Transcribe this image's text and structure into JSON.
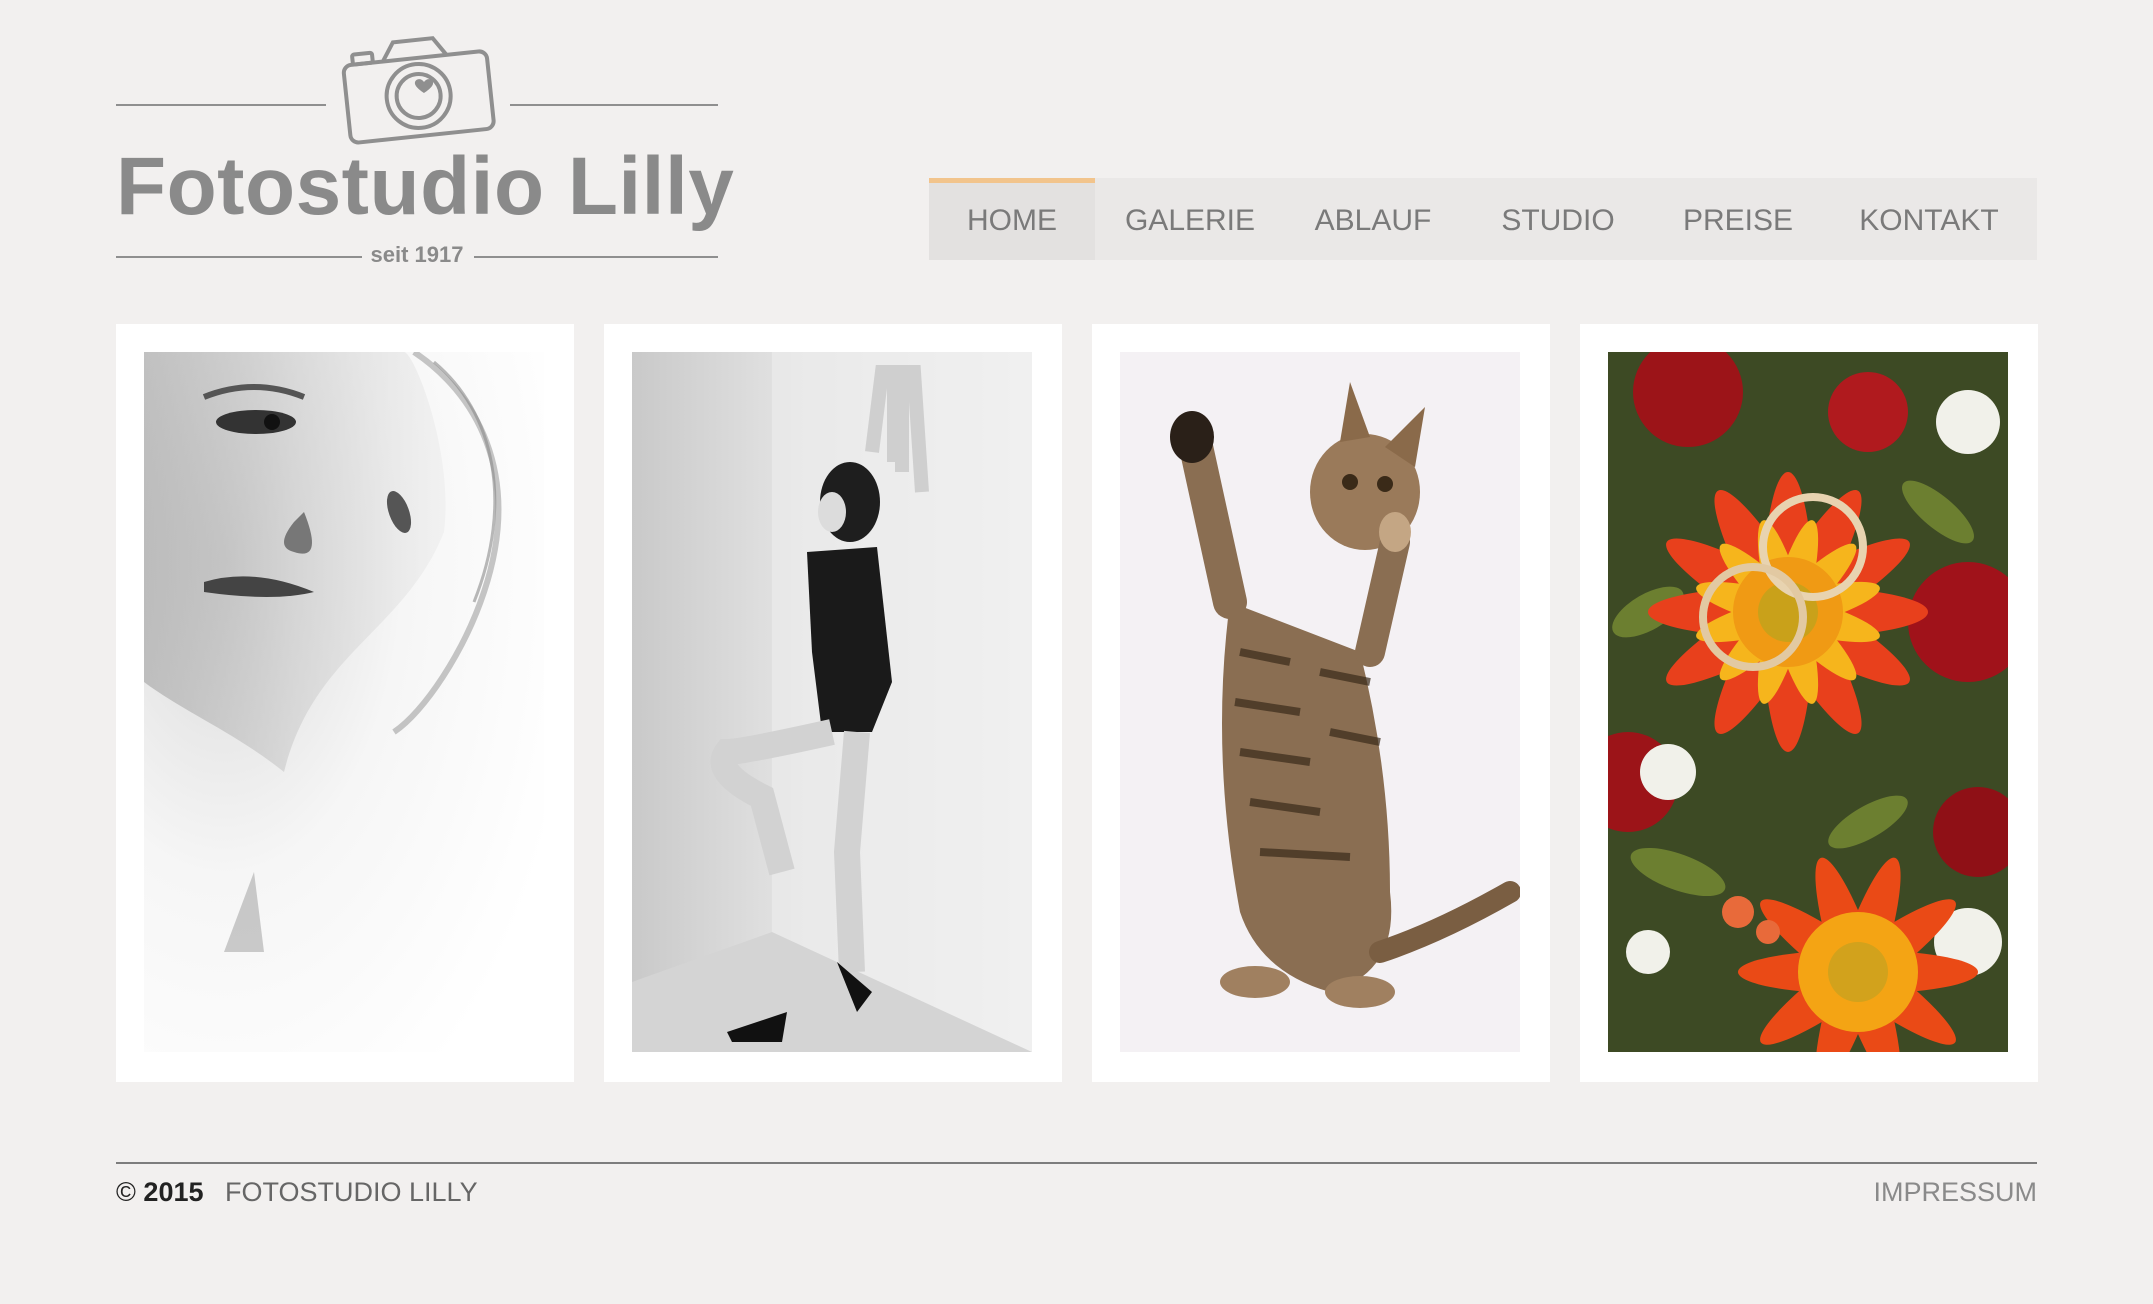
{
  "logo": {
    "name": "Fotostudio Lilly",
    "since": "seit 1917",
    "icon": "camera-heart-icon"
  },
  "nav": {
    "items": [
      {
        "label": "HOME",
        "active": true
      },
      {
        "label": "GALERIE",
        "active": false
      },
      {
        "label": "ABLAUF",
        "active": false
      },
      {
        "label": "STUDIO",
        "active": false
      },
      {
        "label": "PREISE",
        "active": false
      },
      {
        "label": "KONTAKT",
        "active": false
      }
    ],
    "accent_color": "#f2c48c"
  },
  "gallery": {
    "photos": [
      {
        "subject": "portrait-woman-bw"
      },
      {
        "subject": "woman-lingerie-bw"
      },
      {
        "subject": "tabby-cat"
      },
      {
        "subject": "gerbera-bouquet-rings"
      }
    ]
  },
  "footer": {
    "copyright_symbol": "©",
    "year": "2015",
    "studio": "FOTOSTUDIO LILLY",
    "impressum": "IMPRESSUM"
  },
  "colors": {
    "background": "#f2f0ef",
    "logo_gray": "#8a8a8a"
  }
}
